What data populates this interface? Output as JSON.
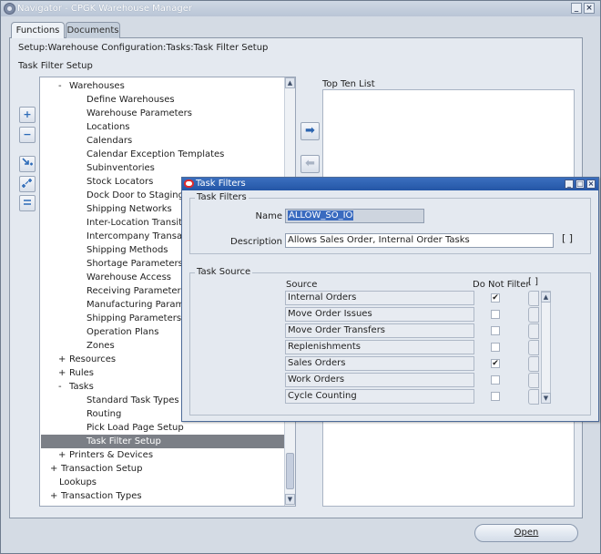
{
  "window": {
    "title": "Navigator - CPGK Warehouse Manager",
    "controls": [
      "_",
      "×"
    ]
  },
  "tabs": [
    {
      "label": "Functions",
      "active": true
    },
    {
      "label": "Documents",
      "active": false
    }
  ],
  "breadcrumb": "Setup:Warehouse Configuration:Tasks:Task Filter Setup",
  "section_title": "Task Filter Setup",
  "side_buttons": [
    "+",
    "−",
    "expand-branch",
    "expand-all",
    "collapse-all"
  ],
  "tree": [
    {
      "label": "Warehouses",
      "level": 1,
      "expander": "-"
    },
    {
      "label": "Define Warehouses",
      "level": 2
    },
    {
      "label": "Warehouse Parameters",
      "level": 2
    },
    {
      "label": "Locations",
      "level": 2
    },
    {
      "label": "Calendars",
      "level": 2
    },
    {
      "label": "Calendar Exception Templates",
      "level": 2
    },
    {
      "label": "Subinventories",
      "level": 2
    },
    {
      "label": "Stock Locators",
      "level": 2
    },
    {
      "label": "Dock Door to Staging Lane",
      "level": 2
    },
    {
      "label": "Shipping Networks",
      "level": 2
    },
    {
      "label": "Inter-Location Transit Times",
      "level": 2
    },
    {
      "label": "Intercompany Transaction",
      "level": 2
    },
    {
      "label": "Shipping Methods",
      "level": 2
    },
    {
      "label": "Shortage Parameters",
      "level": 2
    },
    {
      "label": "Warehouse Access",
      "level": 2
    },
    {
      "label": "Receiving Parameters",
      "level": 2
    },
    {
      "label": "Manufacturing Parameters",
      "level": 2
    },
    {
      "label": "Shipping Parameters",
      "level": 2
    },
    {
      "label": "Operation Plans",
      "level": 2
    },
    {
      "label": "Zones",
      "level": 2
    },
    {
      "label": "Resources",
      "level": 1,
      "expander": "+"
    },
    {
      "label": "Rules",
      "level": 1,
      "expander": "+"
    },
    {
      "label": "Tasks",
      "level": 1,
      "expander": "-"
    },
    {
      "label": "Standard Task Types",
      "level": 2
    },
    {
      "label": "Routing",
      "level": 2
    },
    {
      "label": "Pick Load Page Setup",
      "level": 2
    },
    {
      "label": "Task Filter Setup",
      "level": 2,
      "selected": true
    },
    {
      "label": "Printers & Devices",
      "level": 1,
      "expander": "+"
    },
    {
      "label": "Transaction Setup",
      "level": 0,
      "expander": "+"
    },
    {
      "label": "Lookups",
      "level": 0
    },
    {
      "label": "Transaction Types",
      "level": 0,
      "expander": "+"
    }
  ],
  "top_ten": {
    "label": "Top Ten List"
  },
  "open_button": {
    "label": "Open"
  },
  "dialog": {
    "title": "Task Filters",
    "controls": [
      "_",
      "□",
      "×"
    ],
    "filters_group": "Task Filters",
    "name_label": "Name",
    "name_value": "ALLOW_SO_IO",
    "description_label": "Description",
    "description_value": "Allows Sales Order, Internal Order Tasks",
    "bracket": "[ ]",
    "source_group": "Task Source",
    "source_header": "Source",
    "dnf_header": "Do Not Filter",
    "sources": [
      {
        "name": "Internal Orders",
        "checked": true
      },
      {
        "name": "Move Order Issues",
        "checked": false
      },
      {
        "name": "Move Order Transfers",
        "checked": false
      },
      {
        "name": "Replenishments",
        "checked": false
      },
      {
        "name": "Sales Orders",
        "checked": true
      },
      {
        "name": "Work Orders",
        "checked": false
      },
      {
        "name": "Cycle Counting",
        "checked": false
      }
    ]
  },
  "colors": {
    "accent": "#2456a6",
    "selection": "#7b7f86",
    "panel": "#e4e9f0"
  }
}
